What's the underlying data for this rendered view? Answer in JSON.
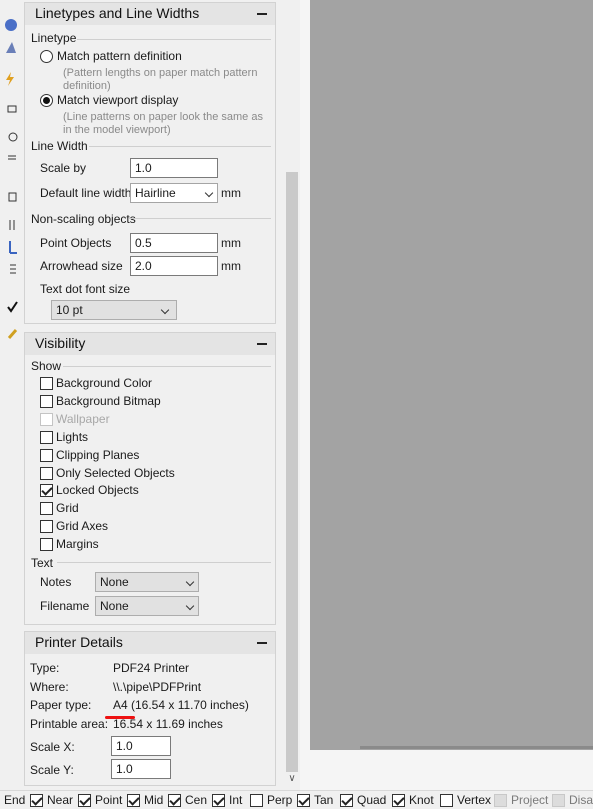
{
  "linetypes": {
    "title": "Linetypes and Line Widths",
    "linetype_section": "Linetype",
    "options": [
      {
        "label": "Match pattern definition",
        "hint": "(Pattern lengths on paper match pattern definition)",
        "selected": false
      },
      {
        "label": "Match viewport display",
        "hint": "(Line patterns on paper look the same as in the model viewport)",
        "selected": true
      }
    ],
    "linewidth_section": "Line Width",
    "scale_by_label": "Scale by",
    "scale_by_value": "1.0",
    "default_width_label": "Default line width",
    "default_width_value": "Hairline",
    "default_width_unit": "mm",
    "nonscaling_section": "Non-scaling objects",
    "point_objects_label": "Point Objects",
    "point_objects_value": "0.5",
    "point_objects_unit": "mm",
    "arrowhead_label": "Arrowhead size",
    "arrowhead_value": "2.0",
    "arrowhead_unit": "mm",
    "textdot_label": "Text dot font size",
    "textdot_value": "10 pt"
  },
  "visibility": {
    "title": "Visibility",
    "show_section": "Show",
    "items": [
      {
        "label": "Background Color",
        "checked": false,
        "enabled": true
      },
      {
        "label": "Background Bitmap",
        "checked": false,
        "enabled": true
      },
      {
        "label": "Wallpaper",
        "checked": false,
        "enabled": false
      },
      {
        "label": "Lights",
        "checked": false,
        "enabled": true
      },
      {
        "label": "Clipping Planes",
        "checked": false,
        "enabled": true
      },
      {
        "label": "Only Selected Objects",
        "checked": false,
        "enabled": true
      },
      {
        "label": "Locked Objects",
        "checked": true,
        "enabled": true
      },
      {
        "label": "Grid",
        "checked": false,
        "enabled": true
      },
      {
        "label": "Grid Axes",
        "checked": false,
        "enabled": true
      },
      {
        "label": "Margins",
        "checked": false,
        "enabled": true
      }
    ],
    "text_section": "Text",
    "notes_label": "Notes",
    "notes_value": "None",
    "filename_label": "Filename",
    "filename_value": "None"
  },
  "printer": {
    "title": "Printer Details",
    "type_label": "Type:",
    "type_value": "PDF24 Printer",
    "where_label": "Where:",
    "where_value": "\\\\.\\pipe\\PDFPrint",
    "paper_label": "Paper type:",
    "paper_size": "A4",
    "paper_dims": "(16.54 x 11.70 inches)",
    "printable_label": "Printable area:",
    "printable_value": "16.54 x 11.69 inches",
    "scalex_label": "Scale X:",
    "scalex_value": "1.0",
    "scaley_label": "Scale Y:",
    "scaley_value": "1.0"
  },
  "statusbar": {
    "items": [
      {
        "label": "End",
        "checked": null
      },
      {
        "label": "Near",
        "checked": true
      },
      {
        "label": "Point",
        "checked": true
      },
      {
        "label": "Mid",
        "checked": true
      },
      {
        "label": "Cen",
        "checked": true
      },
      {
        "label": "Int",
        "checked": true
      },
      {
        "label": "Perp",
        "checked": false
      },
      {
        "label": "Tan",
        "checked": true
      },
      {
        "label": "Quad",
        "checked": true
      },
      {
        "label": "Knot",
        "checked": true
      },
      {
        "label": "Vertex",
        "checked": false
      },
      {
        "label": "Project",
        "checked": false,
        "gray": true
      },
      {
        "label": "Disab",
        "checked": false,
        "gray": true
      }
    ]
  }
}
